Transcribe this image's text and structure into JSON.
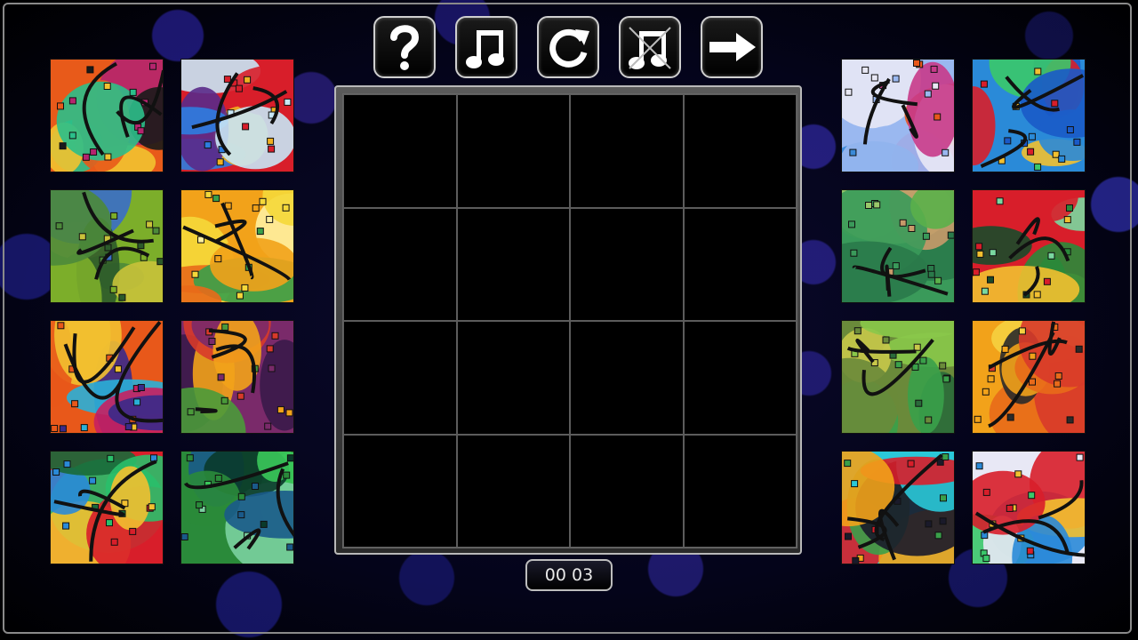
{
  "toolbar": {
    "buttons": [
      {
        "name": "help-button",
        "icon": "question-mark-icon"
      },
      {
        "name": "music-on-button",
        "icon": "music-note-icon"
      },
      {
        "name": "restart-button",
        "icon": "refresh-icon"
      },
      {
        "name": "music-off-button",
        "icon": "music-note-crossed-icon"
      },
      {
        "name": "next-button",
        "icon": "right-arrow-icon"
      }
    ]
  },
  "board": {
    "rows": 4,
    "cols": 4,
    "placed_pieces": 0
  },
  "timer": {
    "value": "00 03"
  },
  "tray": {
    "left_tiles": [
      {
        "name": "tile-left-1",
        "colors": [
          "#e85a1a",
          "#f2c230",
          "#2bbf8a",
          "#b5246e",
          "#1a1a1a"
        ]
      },
      {
        "name": "tile-left-2",
        "colors": [
          "#d81e2a",
          "#2e7de0",
          "#c8e6f5",
          "#f0b020",
          "#5a2a8a"
        ]
      },
      {
        "name": "tile-left-3",
        "colors": [
          "#7cae2a",
          "#4c8a3a",
          "#c9c23a",
          "#3a6ec8",
          "#2c5a2a"
        ]
      },
      {
        "name": "tile-left-4",
        "colors": [
          "#f2a21a",
          "#f5d83a",
          "#e86a1a",
          "#fff0a0",
          "#3aa04a"
        ]
      },
      {
        "name": "tile-left-5",
        "colors": [
          "#e8581a",
          "#3a2a8a",
          "#f2c030",
          "#2ab0d8",
          "#c82060"
        ]
      },
      {
        "name": "tile-left-6",
        "colors": [
          "#7a2a6a",
          "#3a1a4a",
          "#f2a21a",
          "#d83a2a",
          "#4a9a3a"
        ]
      },
      {
        "name": "tile-left-7",
        "colors": [
          "#d81e2a",
          "#2abf6a",
          "#f2c030",
          "#2a8ad8",
          "#1a6a3a"
        ]
      },
      {
        "name": "tile-left-8",
        "colors": [
          "#2a8a3a",
          "#3ac85a",
          "#1a5a8a",
          "#7ad0a0",
          "#0a3a2a"
        ]
      }
    ],
    "right_tiles": [
      {
        "name": "tile-right-1",
        "colors": [
          "#9ab8f0",
          "#e8e8f5",
          "#c83a8a",
          "#e8581a",
          "#3a8ad8"
        ]
      },
      {
        "name": "tile-right-2",
        "colors": [
          "#2a8ad8",
          "#1a5ac8",
          "#d81e2a",
          "#f2c030",
          "#3ac86a"
        ]
      },
      {
        "name": "tile-right-3",
        "colors": [
          "#3a9a5a",
          "#5ab04a",
          "#2a7a4a",
          "#9ac86a",
          "#c89a6a"
        ]
      },
      {
        "name": "tile-right-4",
        "colors": [
          "#d81e2a",
          "#2a8a3a",
          "#f2c030",
          "#1a4a2a",
          "#7ad8a0"
        ]
      },
      {
        "name": "tile-right-5",
        "colors": [
          "#6a8a3a",
          "#3aa04a",
          "#8ac84a",
          "#2a6a3a",
          "#c8c84a"
        ]
      },
      {
        "name": "tile-right-6",
        "colors": [
          "#f2a21a",
          "#e86a1a",
          "#d83a2a",
          "#f5d040",
          "#2a2a2a"
        ]
      },
      {
        "name": "tile-right-7",
        "colors": [
          "#2ac8d8",
          "#d81e2a",
          "#f2a21a",
          "#3aa04a",
          "#1a1a2a"
        ]
      },
      {
        "name": "tile-right-8",
        "colors": [
          "#e8e8f5",
          "#2a8ad8",
          "#d81e2a",
          "#3ac86a",
          "#f2c030"
        ]
      }
    ]
  }
}
